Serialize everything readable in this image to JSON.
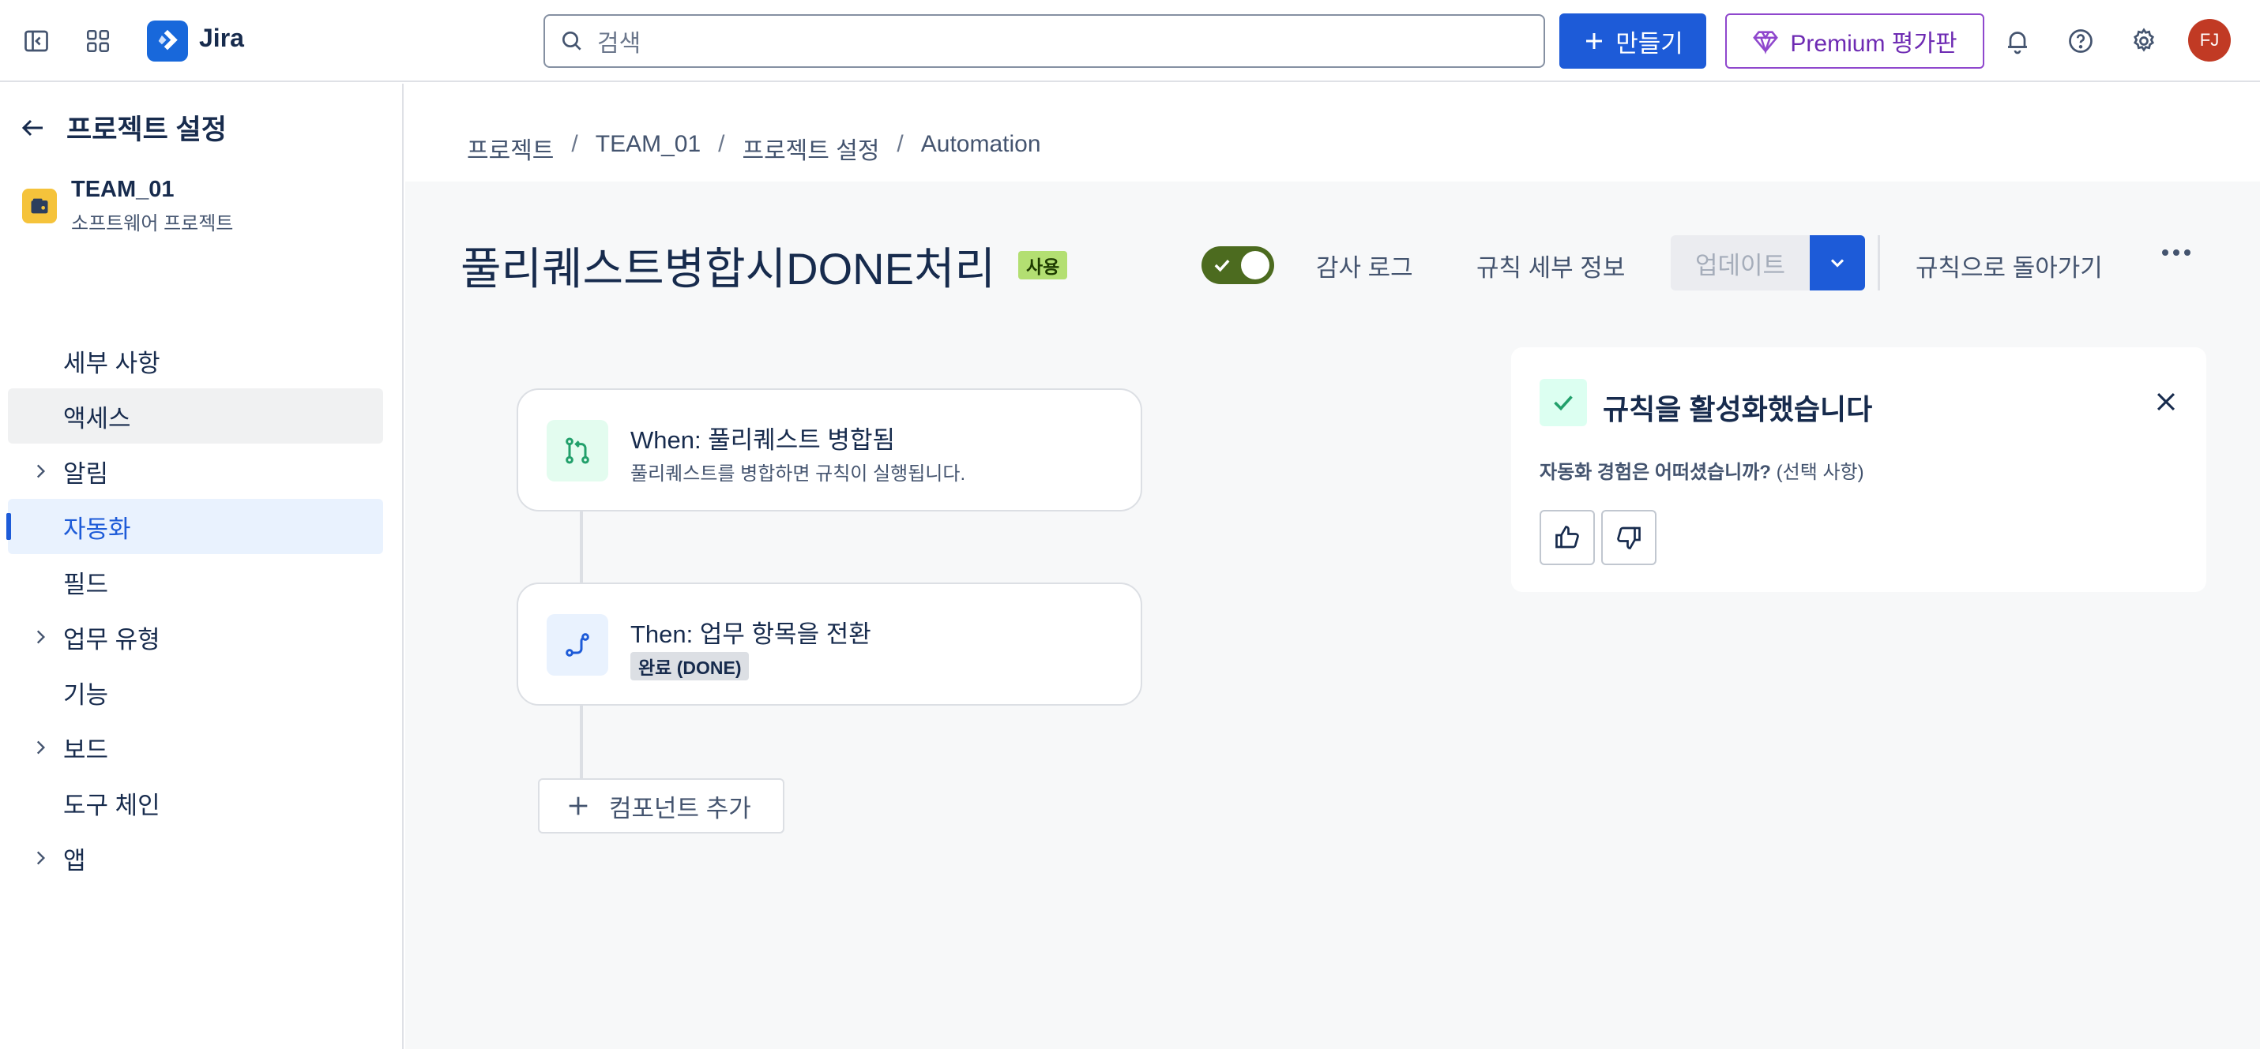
{
  "app": {
    "name": "Jira"
  },
  "search": {
    "placeholder": "검색"
  },
  "header": {
    "create_label": "만들기",
    "premium_label": "Premium 평가판",
    "avatar_initials": "FJ",
    "accent": "#1d5bd8"
  },
  "sidebar": {
    "back_title": "프로젝트 설정",
    "project": {
      "name": "TEAM_01",
      "type": "소프트웨어 프로젝트"
    },
    "items": [
      {
        "label": "세부 사항",
        "expandable": false,
        "state": "normal"
      },
      {
        "label": "액세스",
        "expandable": false,
        "state": "hover"
      },
      {
        "label": "알림",
        "expandable": true,
        "state": "normal"
      },
      {
        "label": "자동화",
        "expandable": false,
        "state": "active"
      },
      {
        "label": "필드",
        "expandable": false,
        "state": "normal"
      },
      {
        "label": "업무 유형",
        "expandable": true,
        "state": "normal"
      },
      {
        "label": "기능",
        "expandable": false,
        "state": "normal"
      },
      {
        "label": "보드",
        "expandable": true,
        "state": "normal"
      },
      {
        "label": "도구 체인",
        "expandable": false,
        "state": "normal"
      },
      {
        "label": "앱",
        "expandable": true,
        "state": "normal"
      }
    ]
  },
  "breadcrumb": [
    "프로젝트",
    "TEAM_01",
    "프로젝트 설정",
    "Automation"
  ],
  "rule": {
    "title": "풀리퀘스트병합시DONE처리",
    "status_badge": "사용",
    "enabled": true,
    "audit_log": "감사 로그",
    "rule_details": "규칙 세부 정보",
    "update": "업데이트",
    "back_to_rules": "규칙으로 돌아가기"
  },
  "flow": {
    "trigger": {
      "title": "When: 풀리퀘스트 병합됨",
      "desc": "풀리퀘스트를 병합하면 규칙이 실행됩니다."
    },
    "action": {
      "title": "Then: 업무 항목을 전환",
      "chip": "완료 (DONE)"
    },
    "add_component": "컴포넌트 추가"
  },
  "toast": {
    "title": "규칙을 활성화했습니다",
    "question": "자동화 경험은 어떠셨습니까?",
    "optional": "(선택 사항)"
  }
}
